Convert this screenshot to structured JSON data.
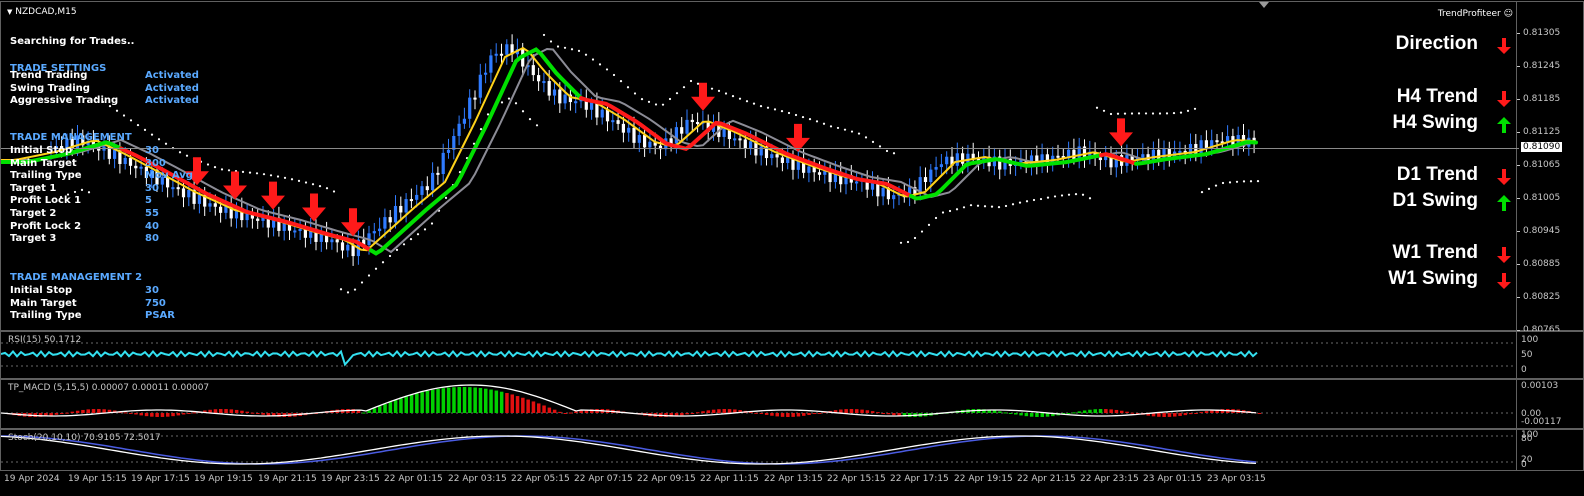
{
  "window": {
    "title": "NZDCAD,M15",
    "badge": "TrendProfiteer"
  },
  "status": "Searching for Trades..",
  "trade_settings": {
    "title": "TRADE SETTINGS",
    "rows": [
      {
        "label": "Trend Trading",
        "value": "Activated"
      },
      {
        "label": "Swing Trading",
        "value": "Activated"
      },
      {
        "label": "Aggressive Trading",
        "value": "Activated"
      }
    ]
  },
  "trade_management": {
    "title": "TRADE MANAGEMENT",
    "rows": [
      {
        "label": "Initial Stop",
        "value": "30"
      },
      {
        "label": "Main Target",
        "value": "300"
      },
      {
        "label": "Trailing Type",
        "value": "Mov Avg"
      },
      {
        "label": "Target 1",
        "value": "30"
      },
      {
        "label": "Profit Lock 1",
        "value": "5"
      },
      {
        "label": "Target 2",
        "value": "55"
      },
      {
        "label": "Profit Lock 2",
        "value": "40"
      },
      {
        "label": "Target 3",
        "value": "80"
      }
    ]
  },
  "trade_management_2": {
    "title": "TRADE MANAGEMENT 2",
    "rows": [
      {
        "label": "Initial Stop",
        "value": "30"
      },
      {
        "label": "Main Target",
        "value": "750"
      },
      {
        "label": "Trailing Type",
        "value": "PSAR"
      }
    ]
  },
  "signals": [
    {
      "label": "Direction",
      "dir": "down"
    },
    {
      "label": "H4 Trend",
      "dir": "down"
    },
    {
      "label": "H4 Swing",
      "dir": "up"
    },
    {
      "label": "D1 Trend",
      "dir": "down"
    },
    {
      "label": "D1 Swing",
      "dir": "up"
    },
    {
      "label": "W1 Trend",
      "dir": "down"
    },
    {
      "label": "W1 Swing",
      "dir": "down"
    }
  ],
  "colors": {
    "up_arrow": "#00e000",
    "down_arrow": "#ff1a1a",
    "bull": "#2f7bff",
    "bear": "#ffffff"
  },
  "price_scale": [
    "0.81305",
    "0.81245",
    "0.81185",
    "0.81125",
    "0.81065",
    "0.81005",
    "0.80945",
    "0.80885",
    "0.80825",
    "0.80765"
  ],
  "current_price": "0.81090",
  "rsi": {
    "title": "RSI(15) 50.1712",
    "scale": [
      "100",
      "50",
      "0"
    ]
  },
  "macd": {
    "title": "TP_MACD (5,15,5) 0.00007 0.00011 0.00007",
    "scale": [
      "0.00103",
      "0.00",
      "-0.00117"
    ]
  },
  "stoch": {
    "title": "Stoch(20,10,10) 70.9105 72.5017",
    "scale": [
      "100",
      "80",
      "20",
      "0"
    ]
  },
  "time_axis": [
    "19 Apr 2024",
    "19 Apr 15:15",
    "19 Apr 17:15",
    "19 Apr 19:15",
    "19 Apr 21:15",
    "19 Apr 23:15",
    "22 Apr 01:15",
    "22 Apr 03:15",
    "22 Apr 05:15",
    "22 Apr 07:15",
    "22 Apr 09:15",
    "22 Apr 11:15",
    "22 Apr 13:15",
    "22 Apr 15:15",
    "22 Apr 17:15",
    "22 Apr 19:15",
    "22 Apr 21:15",
    "22 Apr 23:15",
    "23 Apr 01:15",
    "23 Apr 03:15"
  ]
}
